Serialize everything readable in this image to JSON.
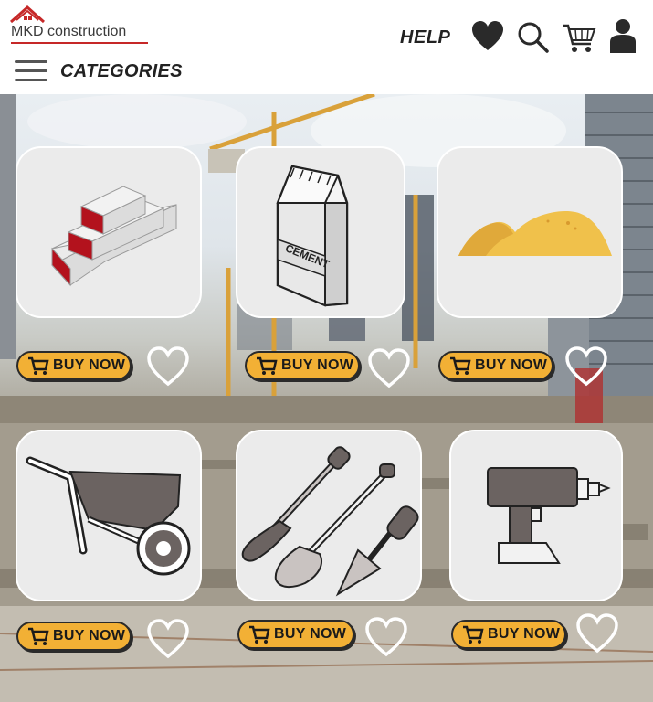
{
  "header": {
    "logo_text": "MKD construction",
    "help_label": "HELP",
    "categories_label": "CATEGORIES",
    "icons": [
      "heart-icon",
      "search-icon",
      "cart-icon",
      "user-icon"
    ]
  },
  "products": [
    {
      "name": "bricks",
      "buy_label": "BUY NOW"
    },
    {
      "name": "cement",
      "buy_label": "BUY NOW",
      "package_text": "CEMENT"
    },
    {
      "name": "sand",
      "buy_label": "BUY NOW"
    },
    {
      "name": "wheelbarrow",
      "buy_label": "BUY NOW"
    },
    {
      "name": "shovel-and-trowels",
      "buy_label": "BUY NOW"
    },
    {
      "name": "power-drill",
      "buy_label": "BUY NOW"
    }
  ],
  "colors": {
    "accent": "#f2b035",
    "brick_red": "#b3121d",
    "sand": "#f0c14b",
    "tool_gray": "#6b6361"
  }
}
